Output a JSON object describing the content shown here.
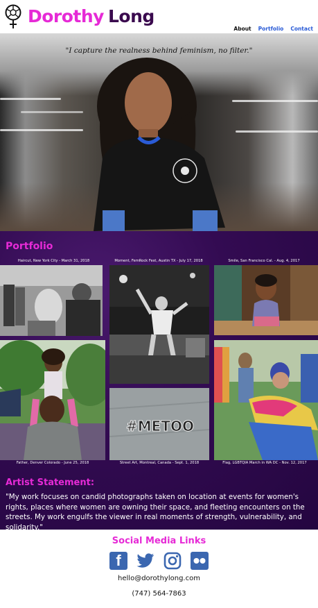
{
  "brand": {
    "first": "Dorothy",
    "last": "Long"
  },
  "nav": {
    "about": "About",
    "portfolio": "Portfolio",
    "contact": "Contact"
  },
  "hero": {
    "quote": "\"I capture the realness behind feminism, no filter.\""
  },
  "portfolio": {
    "title": "Portfolio",
    "captions": {
      "haircut": "Haircut, New York City - March 31, 2018",
      "moment": "Moment, FemRock Fest, Austin TX - July 17, 2018",
      "smile": "Smile, San Francisco Cal. - Aug. 4, 2017",
      "father": "Father, Denver Colorado - June 25, 2018",
      "streetart": "Street Art, Montreal, Canada - Sept. 1, 2018",
      "flag": "Flag, LGBTQIA March in WA DC - Nov. 12, 2017"
    },
    "metoo_text": "#METOO"
  },
  "statement": {
    "title": "Artist Statement:",
    "text": "\"My work focuses on candid photographs taken on location at events for women's rights, places where women are owning their space, and fleeting encounters on the streets. My work engulfs the viewer in real moments of strength, vulnerability, and solidarity.\""
  },
  "social": {
    "title": "Social Media Links",
    "email": "hello@dorothylong.com",
    "phone": "(747) 564-7863"
  },
  "colors": {
    "accent": "#e62ad6",
    "dark": "#3a0a4e",
    "purple_bg": "#330b52",
    "link": "#2a5bd6"
  }
}
